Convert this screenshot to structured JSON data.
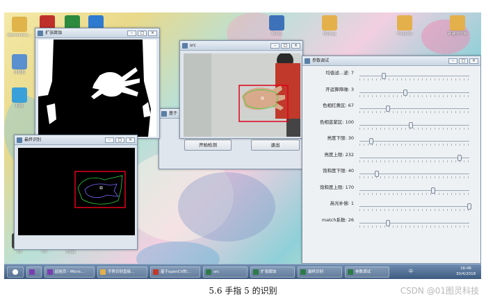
{
  "desktop": {
    "icons": [
      {
        "label": "Administra...",
        "color": "#e0b44a"
      },
      {
        "label": "",
        "color": "#c0302a"
      },
      {
        "label": "",
        "color": "#2b8a3e"
      },
      {
        "label": "",
        "color": "#2f7ad1"
      },
      {
        "label": "计算机",
        "color": "#5a8fd0"
      },
      {
        "label": "网络",
        "color": "#3aa0d9"
      },
      {
        "label": "Proto",
        "color": "#3d72b8"
      },
      {
        "label": "Debug",
        "color": "#e3b04b"
      },
      {
        "label": "Projects",
        "color": "#e3b04b"
      },
      {
        "label": "新建文件夹",
        "color": "#e3b04b"
      },
      {
        "label": "XX",
        "color": "#444444"
      },
      {
        "label": "Pin",
        "color": "#2ea84a"
      },
      {
        "label": "Edge",
        "color": "#1f6fd1"
      },
      {
        "label": "VS",
        "color": "#7a3fb0"
      },
      {
        "label": "",
        "color": "#d04a2a"
      }
    ]
  },
  "windows": {
    "mask": {
      "title": "扩张腐蚀"
    },
    "src": {
      "title": "src"
    },
    "contour": {
      "title": "最终识别"
    },
    "params": {
      "title": "参数调试",
      "sliders": [
        {
          "label": "均值滤...波:",
          "value": 7,
          "fraction": 0.22
        },
        {
          "label": "开运算降噪:",
          "value": 3,
          "fraction": 0.42
        },
        {
          "label": "色相红黄区:",
          "value": 67,
          "fraction": 0.26
        },
        {
          "label": "色相蓝紫区:",
          "value": 100,
          "fraction": 0.47
        },
        {
          "label": "亮度下限:",
          "value": 30,
          "fraction": 0.11
        },
        {
          "label": "亮度上限:",
          "value": 232,
          "fraction": 0.91
        },
        {
          "label": "饱和度下限:",
          "value": 40,
          "fraction": 0.16
        },
        {
          "label": "饱和度上限:",
          "value": 170,
          "fraction": 0.67
        },
        {
          "label": "高光补偿:",
          "value": 1,
          "fraction": 1.0
        },
        {
          "label": "match系数:",
          "value": 26,
          "fraction": 0.26
        }
      ]
    },
    "main": {
      "title": "基于",
      "start_label": "开始检测",
      "exit_label": "退出"
    }
  },
  "taskbar": {
    "items": [
      {
        "label": "",
        "color": "#7a3fb0"
      },
      {
        "label": "起始页 - Micro...",
        "color": "#7a3fb0"
      },
      {
        "label": "手势识别直接...",
        "color": "#e3b04b"
      },
      {
        "label": "基于openCV的...",
        "color": "#c0392b"
      },
      {
        "label": "src",
        "color": "#2f7a4a"
      },
      {
        "label": "扩张腐蚀",
        "color": "#2f7a4a"
      },
      {
        "label": "最终识别",
        "color": "#2f7a4a"
      },
      {
        "label": "参数调试",
        "color": "#2f7a4a"
      }
    ],
    "time": "16:46",
    "date": "30/4/2018",
    "tray": "中"
  },
  "caption": "5.6 手指 5 的识别",
  "watermark": "CSDN @01图灵科技"
}
